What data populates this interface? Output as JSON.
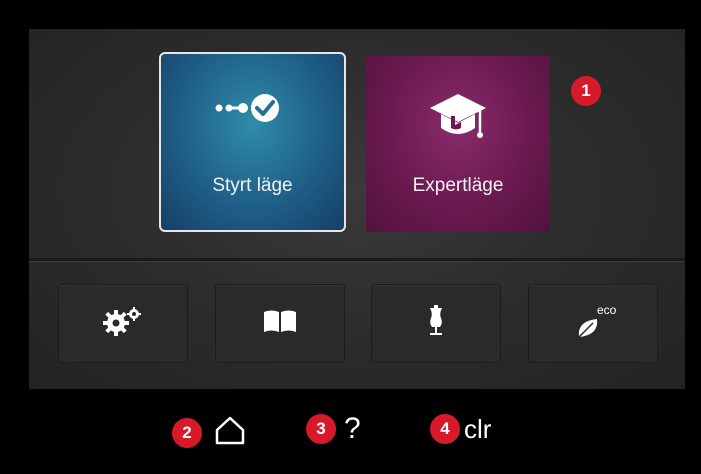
{
  "modes": {
    "guided": {
      "label": "Styrt läge",
      "icon": "guided-path-check-icon",
      "color": "#1f5f88"
    },
    "expert": {
      "label": "Expertläge",
      "icon": "graduation-cap-icon",
      "color": "#6a1a50"
    }
  },
  "toolbar": [
    {
      "icon": "settings-gears-icon"
    },
    {
      "icon": "book-icon"
    },
    {
      "icon": "dress-form-icon"
    },
    {
      "icon": "eco-leaf-icon",
      "caption": "eco"
    }
  ],
  "callouts": [
    "1",
    "2",
    "3",
    "4"
  ],
  "bottom_bar": {
    "home_icon": "home-icon",
    "help_label": "?",
    "clear_label": "clr"
  },
  "colors": {
    "badge": "#d7192a",
    "selected_border": "#e6e6e6"
  }
}
